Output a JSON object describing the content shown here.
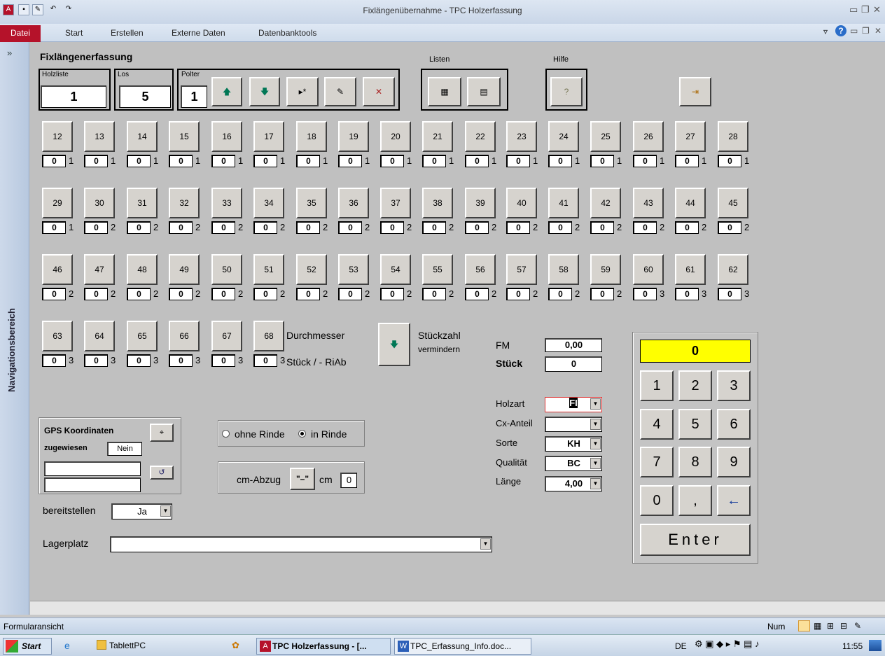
{
  "window": {
    "title": "Fixlängenübernahme - TPC Holzerfassung"
  },
  "ribbon": {
    "file": "Datei",
    "tabs": [
      "Start",
      "Erstellen",
      "Externe Daten",
      "Datenbanktools"
    ]
  },
  "nav": {
    "label": "Navigationsbereich",
    "chevron": "»"
  },
  "form": {
    "title": "Fixlängenerfassung",
    "holzliste_label": "Holzliste",
    "holzliste_value": "1",
    "los_label": "Los",
    "los_value": "5",
    "polter_label": "Polter",
    "polter_value": "1",
    "listen_label": "Listen",
    "hilfe_label": "Hilfe",
    "durchmesser": "Durchmesser",
    "stueck_riab": "Stück / - RiAb",
    "stueckzahl": "Stückzahl",
    "vermindern": "vermindern",
    "fm_label": "FM",
    "fm_value": "0,00",
    "stueck_label": "Stück",
    "stueck_value": "0",
    "holzart_label": "Holzart",
    "holzart_value": "FI",
    "cx_label": "Cx-Anteil",
    "cx_value": "",
    "sorte_label": "Sorte",
    "sorte_value": "KH",
    "qualitaet_label": "Qualität",
    "qualitaet_value": "BC",
    "laenge_label": "Länge",
    "laenge_value": "4,00",
    "gps_title": "GPS Koordinaten",
    "gps_assigned_label": "zugewiesen",
    "gps_assigned_value": "Nein",
    "ohne_rinde": "ohne Rinde",
    "in_rinde": "in Rinde",
    "cm_abzug": "cm-Abzug",
    "cm_abzug_btn": "\"–\"",
    "cm_label": "cm",
    "cm_value": "0",
    "bereitstellen_label": "bereitstellen",
    "bereitstellen_value": "Ja",
    "lagerplatz_label": "Lagerplatz",
    "lagerplatz_value": ""
  },
  "diameters": [
    [
      {
        "d": "12",
        "c": "0",
        "s": "1"
      },
      {
        "d": "13",
        "c": "0",
        "s": "1"
      },
      {
        "d": "14",
        "c": "0",
        "s": "1"
      },
      {
        "d": "15",
        "c": "0",
        "s": "1"
      },
      {
        "d": "16",
        "c": "0",
        "s": "1"
      },
      {
        "d": "17",
        "c": "0",
        "s": "1"
      },
      {
        "d": "18",
        "c": "0",
        "s": "1"
      },
      {
        "d": "19",
        "c": "0",
        "s": "1"
      },
      {
        "d": "20",
        "c": "0",
        "s": "1"
      },
      {
        "d": "21",
        "c": "0",
        "s": "1"
      },
      {
        "d": "22",
        "c": "0",
        "s": "1"
      },
      {
        "d": "23",
        "c": "0",
        "s": "1"
      },
      {
        "d": "24",
        "c": "0",
        "s": "1"
      },
      {
        "d": "25",
        "c": "0",
        "s": "1"
      },
      {
        "d": "26",
        "c": "0",
        "s": "1"
      },
      {
        "d": "27",
        "c": "0",
        "s": "1"
      },
      {
        "d": "28",
        "c": "0",
        "s": "1"
      }
    ],
    [
      {
        "d": "29",
        "c": "0",
        "s": "1"
      },
      {
        "d": "30",
        "c": "0",
        "s": "2"
      },
      {
        "d": "31",
        "c": "0",
        "s": "2"
      },
      {
        "d": "32",
        "c": "0",
        "s": "2"
      },
      {
        "d": "33",
        "c": "0",
        "s": "2"
      },
      {
        "d": "34",
        "c": "0",
        "s": "2"
      },
      {
        "d": "35",
        "c": "0",
        "s": "2"
      },
      {
        "d": "36",
        "c": "0",
        "s": "2"
      },
      {
        "d": "37",
        "c": "0",
        "s": "2"
      },
      {
        "d": "38",
        "c": "0",
        "s": "2"
      },
      {
        "d": "39",
        "c": "0",
        "s": "2"
      },
      {
        "d": "40",
        "c": "0",
        "s": "2"
      },
      {
        "d": "41",
        "c": "0",
        "s": "2"
      },
      {
        "d": "42",
        "c": "0",
        "s": "2"
      },
      {
        "d": "43",
        "c": "0",
        "s": "2"
      },
      {
        "d": "44",
        "c": "0",
        "s": "2"
      },
      {
        "d": "45",
        "c": "0",
        "s": "2"
      }
    ],
    [
      {
        "d": "46",
        "c": "0",
        "s": "2"
      },
      {
        "d": "47",
        "c": "0",
        "s": "2"
      },
      {
        "d": "48",
        "c": "0",
        "s": "2"
      },
      {
        "d": "49",
        "c": "0",
        "s": "2"
      },
      {
        "d": "50",
        "c": "0",
        "s": "2"
      },
      {
        "d": "51",
        "c": "0",
        "s": "2"
      },
      {
        "d": "52",
        "c": "0",
        "s": "2"
      },
      {
        "d": "53",
        "c": "0",
        "s": "2"
      },
      {
        "d": "54",
        "c": "0",
        "s": "2"
      },
      {
        "d": "55",
        "c": "0",
        "s": "2"
      },
      {
        "d": "56",
        "c": "0",
        "s": "2"
      },
      {
        "d": "57",
        "c": "0",
        "s": "2"
      },
      {
        "d": "58",
        "c": "0",
        "s": "2"
      },
      {
        "d": "59",
        "c": "0",
        "s": "2"
      },
      {
        "d": "60",
        "c": "0",
        "s": "3"
      },
      {
        "d": "61",
        "c": "0",
        "s": "3"
      },
      {
        "d": "62",
        "c": "0",
        "s": "3"
      }
    ],
    [
      {
        "d": "63",
        "c": "0",
        "s": "3"
      },
      {
        "d": "64",
        "c": "0",
        "s": "3"
      },
      {
        "d": "65",
        "c": "0",
        "s": "3"
      },
      {
        "d": "66",
        "c": "0",
        "s": "3"
      },
      {
        "d": "67",
        "c": "0",
        "s": "3"
      },
      {
        "d": "68",
        "c": "0",
        "s": "3"
      }
    ]
  ],
  "keypad": {
    "display": "0",
    "keys": [
      "1",
      "2",
      "3",
      "4",
      "5",
      "6",
      "7",
      "8",
      "9",
      "0",
      ",",
      "←"
    ],
    "enter": "Enter"
  },
  "status": {
    "left": "Formularansicht",
    "num": "Num"
  },
  "taskbar": {
    "start": "Start",
    "items": [
      "TablettPC",
      "TPC Holzerfassung - [...",
      "TPC_Erfassung_Info.doc..."
    ],
    "lang": "DE",
    "time": "11:55"
  }
}
